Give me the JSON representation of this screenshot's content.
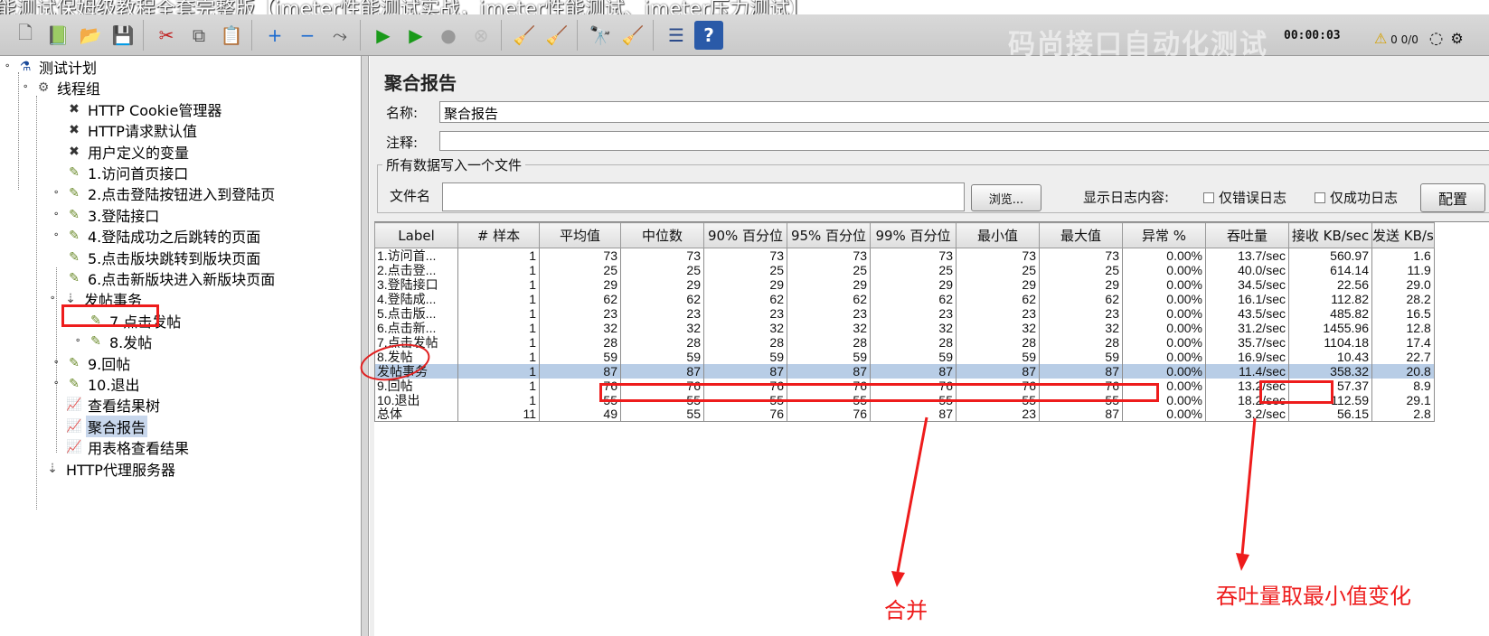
{
  "video_title": "能测试保姆级教程全套完整版【jmeter性能测试实战，jmeter性能测试、jmeter压力测试】",
  "watermark": "码尚接口自动化测试",
  "toolbar": {
    "elapsed_time": "00:00:03",
    "error_count": "0 0/0",
    "buttons": [
      {
        "name": "new-icon",
        "glyph": "🗋"
      },
      {
        "name": "templates-icon",
        "glyph": "📗"
      },
      {
        "name": "open-icon",
        "glyph": "📂"
      },
      {
        "name": "save-icon",
        "glyph": "💾"
      },
      {
        "name": "cut-icon",
        "glyph": "✂"
      },
      {
        "name": "copy-icon",
        "glyph": "⧉"
      },
      {
        "name": "paste-icon",
        "glyph": "📋"
      },
      {
        "name": "expand-icon",
        "glyph": "+"
      },
      {
        "name": "collapse-icon",
        "glyph": "−"
      },
      {
        "name": "toggle-icon",
        "glyph": "⤳"
      },
      {
        "name": "start-icon",
        "glyph": "▶"
      },
      {
        "name": "start-no-pause-icon",
        "glyph": "▶"
      },
      {
        "name": "stop-icon",
        "glyph": "●"
      },
      {
        "name": "shutdown-icon",
        "glyph": "⊗"
      },
      {
        "name": "clear-icon",
        "glyph": "🧹"
      },
      {
        "name": "clear-all-icon",
        "glyph": "🧹"
      },
      {
        "name": "search-icon",
        "glyph": "🔭"
      },
      {
        "name": "reset-search-icon",
        "glyph": "🧹"
      },
      {
        "name": "function-helper-icon",
        "glyph": "☰"
      },
      {
        "name": "help-icon",
        "glyph": "?"
      }
    ]
  },
  "tree": [
    {
      "label": "测试计划",
      "icon": "test-plan-icon",
      "glyph": "⚗"
    },
    {
      "label": "线程组",
      "icon": "thread-group-icon",
      "glyph": "⚙"
    },
    {
      "label": "HTTP Cookie管理器",
      "icon": "config-element-icon",
      "glyph": "✖"
    },
    {
      "label": "HTTP请求默认值",
      "icon": "config-element-icon",
      "glyph": "✖"
    },
    {
      "label": "用户定义的变量",
      "icon": "config-element-icon",
      "glyph": "✖"
    },
    {
      "label": "1.访问首页接口",
      "icon": "sampler-icon",
      "glyph": "✎"
    },
    {
      "label": "2.点击登陆按钮进入到登陆页",
      "icon": "sampler-icon",
      "glyph": "✎"
    },
    {
      "label": "3.登陆接口",
      "icon": "sampler-icon",
      "glyph": "✎"
    },
    {
      "label": "4.登陆成功之后跳转的页面",
      "icon": "sampler-icon",
      "glyph": "✎"
    },
    {
      "label": "5.点击版块跳转到版块页面",
      "icon": "sampler-icon",
      "glyph": "✎"
    },
    {
      "label": "6.点击新版块进入新版块页面",
      "icon": "sampler-icon",
      "glyph": "✎"
    },
    {
      "label": "发帖事务",
      "icon": "transaction-controller-icon",
      "glyph": "⇣"
    },
    {
      "label": "7.点击发帖",
      "icon": "sampler-icon",
      "glyph": "✎"
    },
    {
      "label": "8.发帖",
      "icon": "sampler-icon",
      "glyph": "✎"
    },
    {
      "label": "9.回帖",
      "icon": "sampler-icon",
      "glyph": "✎"
    },
    {
      "label": "10.退出",
      "icon": "sampler-icon",
      "glyph": "✎"
    },
    {
      "label": "查看结果树",
      "icon": "listener-icon",
      "glyph": "📈"
    },
    {
      "label": "聚合报告",
      "icon": "listener-icon",
      "glyph": "📈"
    },
    {
      "label": "用表格查看结果",
      "icon": "listener-icon",
      "glyph": "📈"
    },
    {
      "label": "HTTP代理服务器",
      "icon": "proxy-server-icon",
      "glyph": "⇣"
    }
  ],
  "report": {
    "title": "聚合报告",
    "name_label": "名称:",
    "name_value": "聚合报告",
    "comment_label": "注释:",
    "comment_value": "",
    "file_group_title": "所有数据写入一个文件",
    "file_label": "文件名",
    "file_value": "",
    "browse_button": "浏览...",
    "log_label": "显示日志内容:",
    "errors_only": "仅错误日志",
    "success_only": "仅成功日志",
    "config_button": "配置"
  },
  "table": {
    "columns": [
      "Label",
      "# 样本",
      "平均值",
      "中位数",
      "90% 百分位",
      "95% 百分位",
      "99% 百分位",
      "最小值",
      "最大值",
      "异常 %",
      "吞吐量",
      "接收 KB/sec",
      "发送 KB/s"
    ],
    "rows": [
      [
        "1.访问首...",
        "1",
        "73",
        "73",
        "73",
        "73",
        "73",
        "73",
        "73",
        "0.00%",
        "13.7/sec",
        "560.97",
        "1.6"
      ],
      [
        "2.点击登...",
        "1",
        "25",
        "25",
        "25",
        "25",
        "25",
        "25",
        "25",
        "0.00%",
        "40.0/sec",
        "614.14",
        "11.9"
      ],
      [
        "3.登陆接口",
        "1",
        "29",
        "29",
        "29",
        "29",
        "29",
        "29",
        "29",
        "0.00%",
        "34.5/sec",
        "22.56",
        "29.0"
      ],
      [
        "4.登陆成...",
        "1",
        "62",
        "62",
        "62",
        "62",
        "62",
        "62",
        "62",
        "0.00%",
        "16.1/sec",
        "112.82",
        "28.2"
      ],
      [
        "5.点击版...",
        "1",
        "23",
        "23",
        "23",
        "23",
        "23",
        "23",
        "23",
        "0.00%",
        "43.5/sec",
        "485.82",
        "16.5"
      ],
      [
        "6.点击新...",
        "1",
        "32",
        "32",
        "32",
        "32",
        "32",
        "32",
        "32",
        "0.00%",
        "31.2/sec",
        "1455.96",
        "12.8"
      ],
      [
        "7.点击发帖",
        "1",
        "28",
        "28",
        "28",
        "28",
        "28",
        "28",
        "28",
        "0.00%",
        "35.7/sec",
        "1104.18",
        "17.4"
      ],
      [
        "8.发帖",
        "1",
        "59",
        "59",
        "59",
        "59",
        "59",
        "59",
        "59",
        "0.00%",
        "16.9/sec",
        "10.43",
        "22.7"
      ],
      [
        "发帖事务",
        "1",
        "87",
        "87",
        "87",
        "87",
        "87",
        "87",
        "87",
        "0.00%",
        "11.4/sec",
        "358.32",
        "20.8"
      ],
      [
        "9.回帖",
        "1",
        "76",
        "76",
        "76",
        "76",
        "76",
        "76",
        "76",
        "0.00%",
        "13.2/sec",
        "57.37",
        "8.9"
      ],
      [
        "10.退出",
        "1",
        "55",
        "55",
        "55",
        "55",
        "55",
        "55",
        "55",
        "0.00%",
        "18.2/sec",
        "112.59",
        "29.1"
      ],
      [
        "总体",
        "11",
        "49",
        "55",
        "76",
        "76",
        "87",
        "23",
        "87",
        "0.00%",
        "3.2/sec",
        "56.15",
        "2.8"
      ]
    ],
    "selected_row": 8
  },
  "annotations": {
    "merge": "合并",
    "throughput_note": "吞吐量取最小值变化",
    "color": "#ee1c1c"
  }
}
